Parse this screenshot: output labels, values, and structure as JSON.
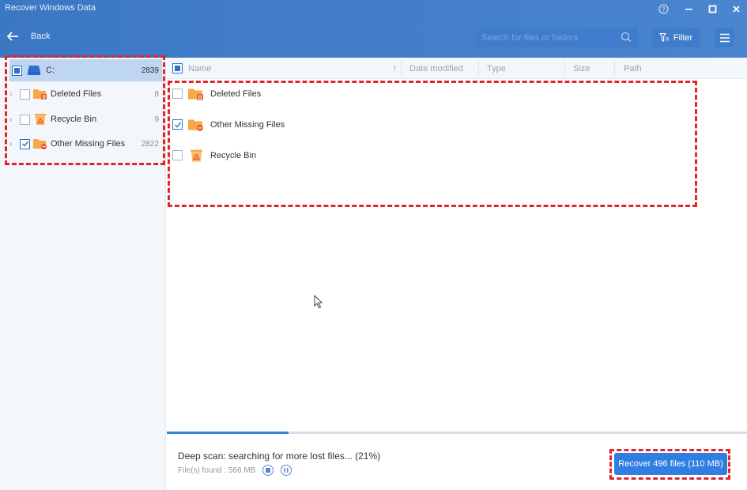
{
  "window": {
    "title": "Recover Windows Data",
    "controls": {
      "help": "?",
      "minimize": "—",
      "maximize": "□",
      "close": "✕"
    }
  },
  "toolbar": {
    "back_label": "Back",
    "search_placeholder": "Search for files or folders",
    "search_value": "",
    "filter_label": "Filter"
  },
  "sidebar": {
    "root": {
      "label": "C:",
      "count": "2839",
      "checkbox": "partial",
      "expanded": true,
      "icon": "drive-icon"
    },
    "items": [
      {
        "label": "Deleted Files",
        "count": "8",
        "checked": false,
        "icon": "deleted-folder-icon"
      },
      {
        "label": "Recycle Bin",
        "count": "9",
        "checked": false,
        "icon": "recycle-bin-icon"
      },
      {
        "label": "Other Missing Files",
        "count": "2822",
        "checked": true,
        "icon": "missing-folder-icon"
      }
    ]
  },
  "table": {
    "columns": [
      "Name",
      "Date modified",
      "Type",
      "Size",
      "Path"
    ],
    "sort_indicator": "↑",
    "header_checkbox": "partial",
    "rows": [
      {
        "name": "Deleted Files",
        "checked": false,
        "icon": "deleted-folder-icon"
      },
      {
        "name": "Other Missing Files",
        "checked": true,
        "icon": "missing-folder-icon"
      },
      {
        "name": "Recycle Bin",
        "checked": false,
        "icon": "recycle-bin-icon"
      }
    ]
  },
  "status": {
    "progress_percent": 21,
    "message": "Deep scan: searching for more lost files... (21%)",
    "found_label": "File(s) found : 566 MB"
  },
  "recover_button": {
    "label": "Recover 496 files (110 MB)"
  },
  "colors": {
    "header_blue": "#3b78c4",
    "accent_blue": "#2f7ee0",
    "folder_orange": "#f5a947",
    "badge_red": "#e9572b",
    "annotation_red": "#e0262b"
  }
}
